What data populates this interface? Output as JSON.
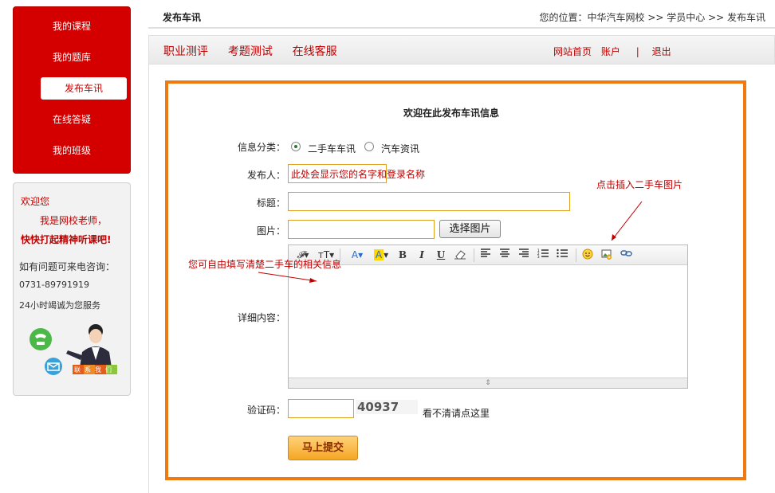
{
  "sidebar": {
    "menu": [
      {
        "label": "我的课程"
      },
      {
        "label": "我的题库"
      },
      {
        "label": "发布车讯",
        "active": true
      },
      {
        "label": "在线答疑"
      },
      {
        "label": "我的班级"
      }
    ],
    "welcome": "欢迎您",
    "teacher": "我是网校老师，",
    "lesson_prompt": "快快打起精神听课吧!",
    "contact_label": "如有问题可来电咨询：",
    "phone": "0731-89791919",
    "service": "24小时竭诚为您服务",
    "contact_badge": "联系我们"
  },
  "header": {
    "page_title": "发布车讯",
    "breadcrumb": "您的位置：中华汽车网校 >> 学员中心 >> 发布车讯"
  },
  "nav": {
    "left": [
      "职业测评",
      "考题测试",
      "在线客服"
    ],
    "home": "网站首页",
    "account": "账户",
    "divider": "|",
    "logout": "退出"
  },
  "form": {
    "heading": "欢迎在此发布车讯信息",
    "category_label": "信息分类：",
    "category_options": [
      {
        "label": "二手车车讯",
        "checked": true
      },
      {
        "label": "汽车资讯",
        "checked": false
      }
    ],
    "publisher_label": "发布人：",
    "publisher_value": "此处会显示您的名字和登录名称",
    "title_label": "标题：",
    "title_value": "",
    "image_label": "图片：",
    "image_value": "",
    "choose_image_button": "选择图片",
    "detail_label": "详细内容：",
    "captcha_label": "验证码：",
    "captcha_value": "",
    "captcha_code": "40937",
    "captcha_refresh": "看不清请点这里",
    "submit_button": "马上提交"
  },
  "editor_toolbar": [
    "font-family",
    "font-size",
    "font-color",
    "highlight",
    "B",
    "I",
    "U",
    "eraser",
    "align-left",
    "align-center",
    "align-right",
    "ordered-list",
    "unordered-list",
    "emoticon",
    "insert-image",
    "insert-link"
  ],
  "annotations": {
    "insert_image_hint": "点击插入二手车图片",
    "detail_hint": "您可自由填写清楚二手车的相关信息"
  },
  "colors": {
    "brand_red": "#d40000",
    "frame_orange": "#f07a10",
    "input_border": "#e0a020"
  }
}
